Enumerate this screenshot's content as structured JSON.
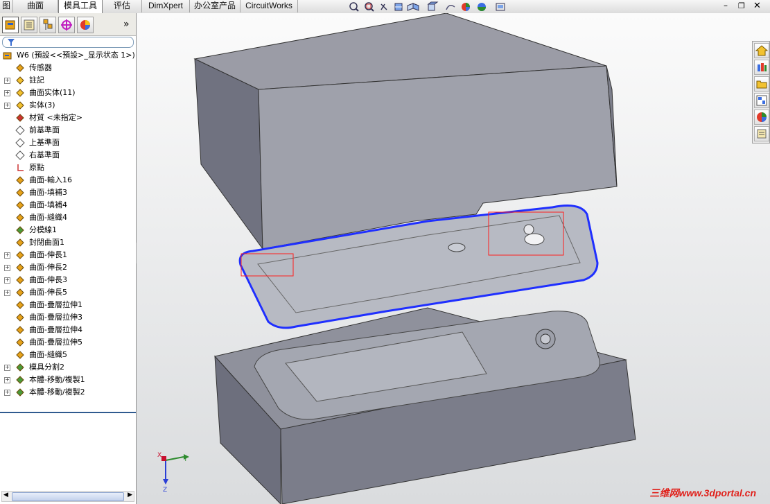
{
  "tabs": [
    {
      "label": "图",
      "active": false
    },
    {
      "label": "曲面",
      "active": false
    },
    {
      "label": "模具工具",
      "active": true
    },
    {
      "label": "评估",
      "active": false
    },
    {
      "label": "DimXpert",
      "active": false
    },
    {
      "label": "办公室产品",
      "active": false
    },
    {
      "label": "CircuitWorks",
      "active": false
    }
  ],
  "panel": {
    "tab_icons": [
      "feature-manager-icon",
      "property-manager-icon",
      "configuration-manager-icon",
      "dimxpert-manager-icon",
      "display-manager-icon"
    ],
    "more_label": "»"
  },
  "tree": {
    "root": "W6  (預設<<預設>_显示状态 1>)",
    "items": [
      {
        "label": "传感器",
        "icon": "sensor-icon",
        "expandable": false
      },
      {
        "label": "註記",
        "icon": "annotation-icon",
        "expandable": true
      },
      {
        "label": "曲面实体(11)",
        "icon": "surface-bodies-icon",
        "expandable": true
      },
      {
        "label": "实体(3)",
        "icon": "solid-bodies-icon",
        "expandable": true
      },
      {
        "label": "材質 <未指定>",
        "icon": "material-icon",
        "expandable": false
      },
      {
        "label": "前基準面",
        "icon": "plane-icon",
        "expandable": false
      },
      {
        "label": "上基準面",
        "icon": "plane-icon",
        "expandable": false
      },
      {
        "label": "右基準面",
        "icon": "plane-icon",
        "expandable": false
      },
      {
        "label": "原點",
        "icon": "origin-icon",
        "expandable": false
      },
      {
        "label": "曲面-輸入16",
        "icon": "surface-import-icon",
        "expandable": false
      },
      {
        "label": "曲面-填補3",
        "icon": "surface-fill-icon",
        "expandable": false
      },
      {
        "label": "曲面-填補4",
        "icon": "surface-fill-icon",
        "expandable": false
      },
      {
        "label": "曲面-縫織4",
        "icon": "surface-knit-icon",
        "expandable": false
      },
      {
        "label": "分模線1",
        "icon": "parting-line-icon",
        "expandable": false
      },
      {
        "label": "封閉曲面1",
        "icon": "shut-off-surface-icon",
        "expandable": false
      },
      {
        "label": "曲面-伸長1",
        "icon": "surface-extrude-icon",
        "expandable": true
      },
      {
        "label": "曲面-伸長2",
        "icon": "surface-extrude-icon",
        "expandable": true
      },
      {
        "label": "曲面-伸長3",
        "icon": "surface-extrude-icon",
        "expandable": true
      },
      {
        "label": "曲面-伸長5",
        "icon": "surface-extrude-icon",
        "expandable": true
      },
      {
        "label": "曲面-疊層拉伸1",
        "icon": "surface-loft-icon",
        "expandable": false
      },
      {
        "label": "曲面-疊層拉伸3",
        "icon": "surface-loft-icon",
        "expandable": false
      },
      {
        "label": "曲面-疊層拉伸4",
        "icon": "surface-loft-icon",
        "expandable": false
      },
      {
        "label": "曲面-疊層拉伸5",
        "icon": "surface-loft-icon",
        "expandable": false
      },
      {
        "label": "曲面-縫織5",
        "icon": "surface-knit-icon",
        "expandable": false
      },
      {
        "label": "模具分割2",
        "icon": "tooling-split-icon",
        "expandable": true
      },
      {
        "label": "本體-移動/複製1",
        "icon": "move-copy-body-icon",
        "expandable": true
      },
      {
        "label": "本體-移動/複製2",
        "icon": "move-copy-body-icon",
        "expandable": true
      }
    ]
  },
  "viewport": {
    "hud_icons": [
      "zoom-to-fit-icon",
      "zoom-area-icon",
      "previous-view-icon",
      "section-view-icon",
      "view-orientation-icon",
      "display-style-icon",
      "hide-show-icon",
      "appearance-icon",
      "scene-icon",
      "view-settings-icon"
    ],
    "triad": {
      "x": "X",
      "y": "Y",
      "z": "Z"
    },
    "watermark": "三维网www.3dportal.cn",
    "colors": {
      "mold_top": "#8e9099",
      "mold_side": "#6f7180",
      "parting_line": "#1f2fff",
      "highlight_box": "#ff1e1e"
    }
  },
  "task_pane_icons": [
    "resources-icon",
    "design-library-icon",
    "file-explorer-icon",
    "view-palette-icon",
    "appearances-icon",
    "custom-properties-icon"
  ]
}
